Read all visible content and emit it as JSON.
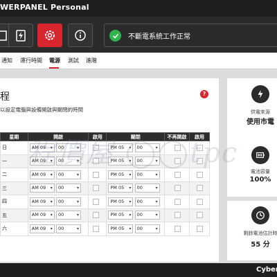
{
  "app": {
    "title": "WERPANEL Personal",
    "brand": "CyberP"
  },
  "toolbar": {
    "buttons": [
      {
        "icon": "ups-icon"
      },
      {
        "icon": "power-icon"
      },
      {
        "icon": "settings-icon"
      },
      {
        "icon": "info-icon"
      }
    ]
  },
  "status": {
    "text": "不斷電系統工作正常",
    "icon": "check-icon"
  },
  "subnav": {
    "items": [
      "通知",
      "運行時間",
      "電源",
      "測試",
      "進階"
    ],
    "active": "電源"
  },
  "schedule": {
    "title": "程",
    "description": "以設定電腦與設備開啟與關閉的時間",
    "help_icon": "?",
    "headers": {
      "day": "星期",
      "on": "開啟",
      "enable_on": "啟用",
      "off": "關閉",
      "no_on": "不再開啟",
      "enable_off": "啟用"
    },
    "rows": [
      {
        "day": "日",
        "on_ampm": "AM 09",
        "on_min": "00",
        "off_ampm": "PM 05",
        "off_min": "00"
      },
      {
        "day": "一",
        "on_ampm": "AM 09",
        "on_min": "00",
        "off_ampm": "PM 05",
        "off_min": "00"
      },
      {
        "day": "二",
        "on_ampm": "AM 09",
        "on_min": "00",
        "off_ampm": "PM 05",
        "off_min": "00"
      },
      {
        "day": "三",
        "on_ampm": "AM 09",
        "on_min": "00",
        "off_ampm": "PM 05",
        "off_min": "00"
      },
      {
        "day": "四",
        "on_ampm": "AM 09",
        "on_min": "00",
        "off_ampm": "PM 05",
        "off_min": "00"
      },
      {
        "day": "五",
        "on_ampm": "AM 09",
        "on_min": "00",
        "off_ampm": "PM 05",
        "off_min": "00"
      },
      {
        "day": "六",
        "on_ampm": "AM 09",
        "on_min": "00",
        "off_ampm": "PM 05",
        "off_min": "00"
      }
    ]
  },
  "cards": {
    "power": {
      "label": "供電來源",
      "value": "使用市電"
    },
    "battery": {
      "label": "電池容量",
      "value": "100%"
    },
    "runtime": {
      "label": "剩餘電池估計時",
      "value": "55 分"
    }
  },
  "watermark": "程價屋 ◯◯tpc",
  "colors": {
    "accent": "#d9252c",
    "ok": "#2fb54a",
    "dark": "#2b2b2b"
  }
}
